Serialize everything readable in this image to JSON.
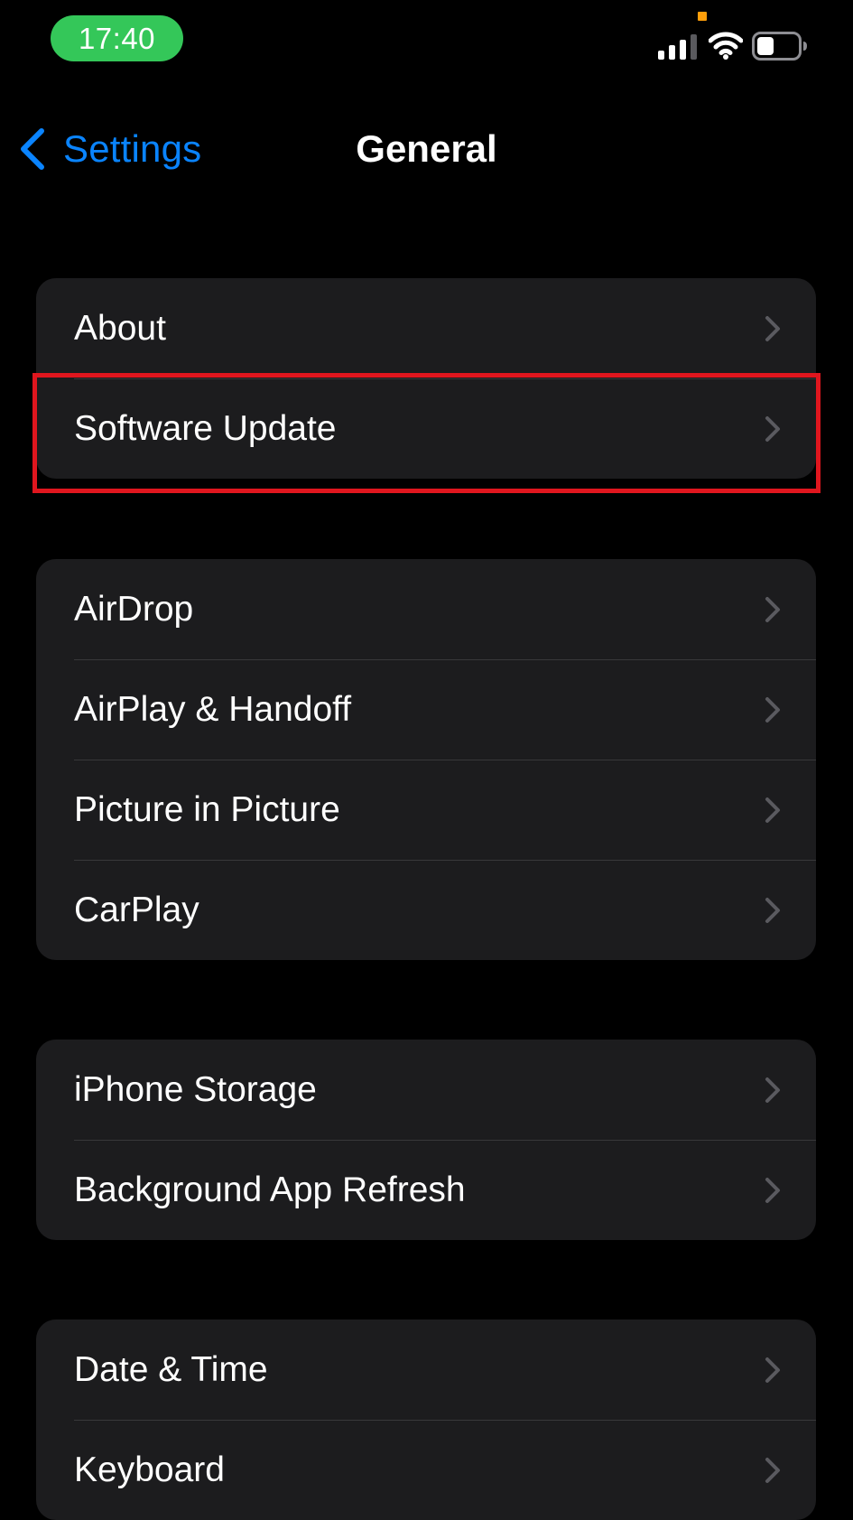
{
  "status_bar": {
    "time": "17:40",
    "icons": [
      "signal-icon",
      "wifi-icon",
      "battery-icon"
    ],
    "time_pill_color": "#34c759"
  },
  "nav": {
    "back_label": "Settings",
    "title": "General",
    "accent_color": "#0a84ff"
  },
  "groups": [
    {
      "rows": [
        {
          "label": "About"
        },
        {
          "label": "Software Update"
        }
      ]
    },
    {
      "rows": [
        {
          "label": "AirDrop"
        },
        {
          "label": "AirPlay & Handoff"
        },
        {
          "label": "Picture in Picture"
        },
        {
          "label": "CarPlay"
        }
      ]
    },
    {
      "rows": [
        {
          "label": "iPhone Storage"
        },
        {
          "label": "Background App Refresh"
        }
      ]
    },
    {
      "rows": [
        {
          "label": "Date & Time"
        },
        {
          "label": "Keyboard"
        }
      ]
    }
  ],
  "highlight": {
    "target": "Software Update",
    "color": "#e0161e"
  }
}
